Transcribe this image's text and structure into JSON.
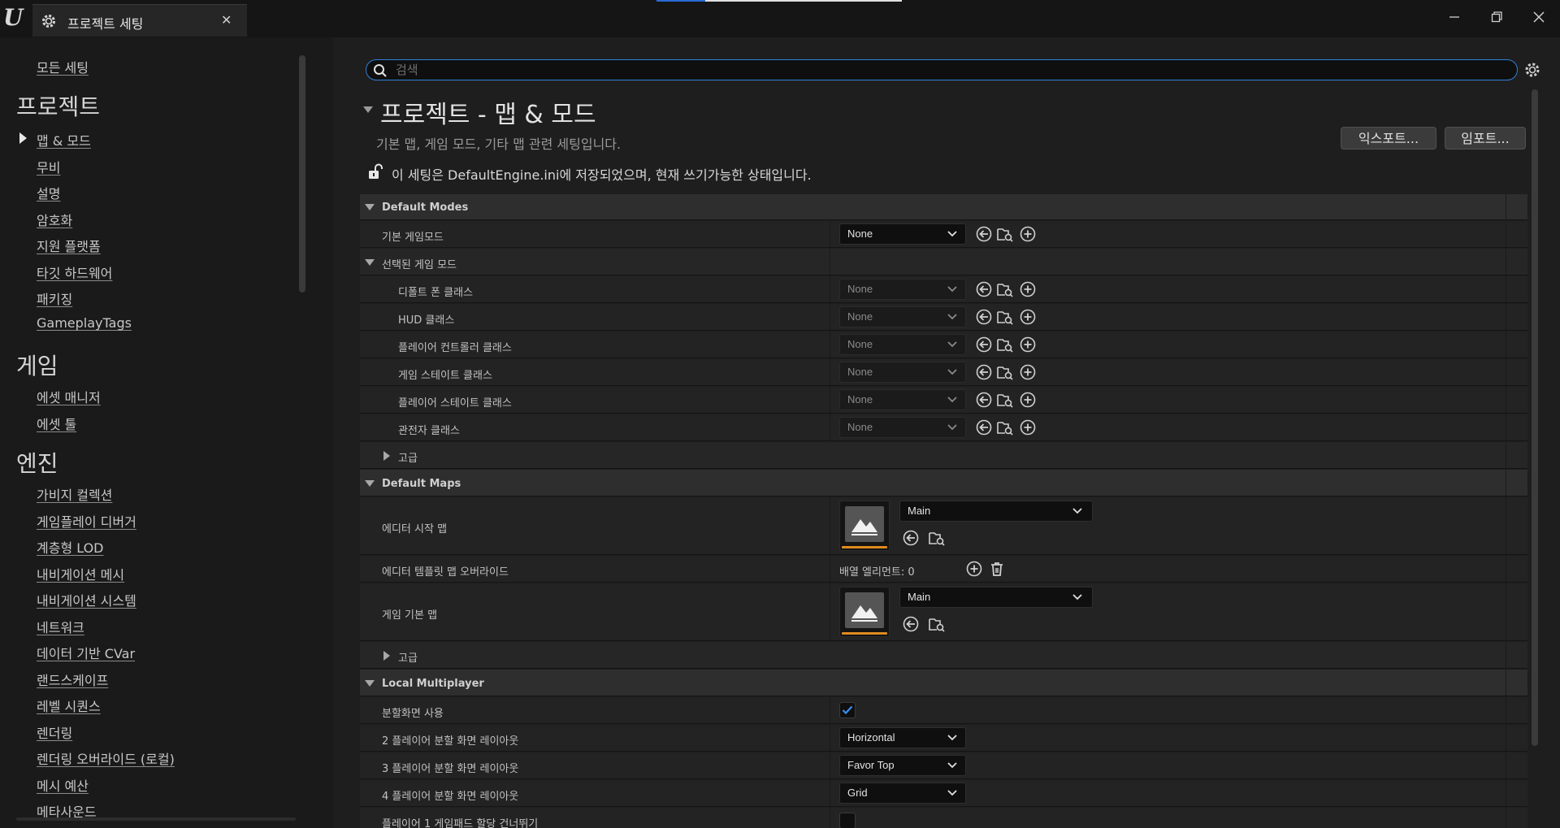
{
  "window": {
    "logo_text": "U",
    "tab_label": "프로젝트 세팅",
    "tab_close": "✕"
  },
  "sidebar": {
    "all_settings": "모든 세팅",
    "categories": [
      {
        "title": "프로젝트",
        "items": [
          "맵 & 모드",
          "무비",
          "설명",
          "암호화",
          "지원 플랫폼",
          "타깃 하드웨어",
          "패키징",
          "GameplayTags"
        ]
      },
      {
        "title": "게임",
        "items": [
          "에셋 매니저",
          "에셋 툴"
        ]
      },
      {
        "title": "엔진",
        "items": [
          "가비지 컬렉션",
          "게임플레이 디버거",
          "계층형 LOD",
          "내비게이션 메시",
          "내비게이션 시스템",
          "네트워크",
          "데이터 기반 CVar",
          "랜드스케이프",
          "레벨 시퀀스",
          "렌더링",
          "렌더링 오버라이드 (로컬)",
          "메시 예산",
          "메타사운드"
        ]
      }
    ]
  },
  "search": {
    "placeholder": "검색",
    "value": ""
  },
  "header": {
    "title": "프로젝트 - 맵 & 모드",
    "subtitle": "기본 맵, 게임 모드, 기타 맵 관련 세팅입니다.",
    "export_label": "익스포트...",
    "import_label": "임포트...",
    "ini_notice": "이 세팅은 DefaultEngine.ini에 저장되었으며, 현재 쓰기가능한 상태입니다."
  },
  "default_modes": {
    "title": "Default Modes",
    "default_gamemode": {
      "label": "기본 게임모드",
      "value": "None"
    },
    "selected_gamemode": "선택된 게임 모드",
    "class_rows": [
      {
        "label": "디폴트 폰 클래스",
        "value": "None"
      },
      {
        "label": "HUD 클래스",
        "value": "None"
      },
      {
        "label": "플레이어 컨트롤러 클래스",
        "value": "None"
      },
      {
        "label": "게임 스테이트 클래스",
        "value": "None"
      },
      {
        "label": "플레이어 스테이트 클래스",
        "value": "None"
      },
      {
        "label": "관전자 클래스",
        "value": "None"
      }
    ],
    "advanced": "고급"
  },
  "default_maps": {
    "title": "Default Maps",
    "editor_startup_map": {
      "label": "에디터 시작 맵",
      "value": "Main"
    },
    "editor_template_override": {
      "label": "에디터 템플릿 맵 오버라이드",
      "array_text": "배열 엘리먼트: 0"
    },
    "game_default_map": {
      "label": "게임 기본 맵",
      "value": "Main"
    },
    "advanced": "고급"
  },
  "local_multiplayer": {
    "title": "Local Multiplayer",
    "use_splitscreen": {
      "label": "분할화면 사용",
      "checked": true
    },
    "two_player_layout": {
      "label": "2 플레이어 분할 화면 레이아웃",
      "value": "Horizontal"
    },
    "three_player_layout": {
      "label": "3 플레이어 분할 화면 레이아웃",
      "value": "Favor Top"
    },
    "four_player_layout": {
      "label": "4 플레이어 분할 화면 레이아웃",
      "value": "Grid"
    },
    "partial_row_label": "플레이어 1 게임패드 할당 건너뛰기"
  },
  "colors": {
    "accent_blue": "#2f7fd9",
    "thumbnail_bar": "#e08a1e",
    "background": "#1e1e1e"
  },
  "icons": {
    "reset": "arrow-left-circle-icon",
    "browse": "folder-search-icon",
    "add": "plus-circle-icon",
    "delete": "trash-icon",
    "lock": "unlocked-padlock-icon"
  }
}
